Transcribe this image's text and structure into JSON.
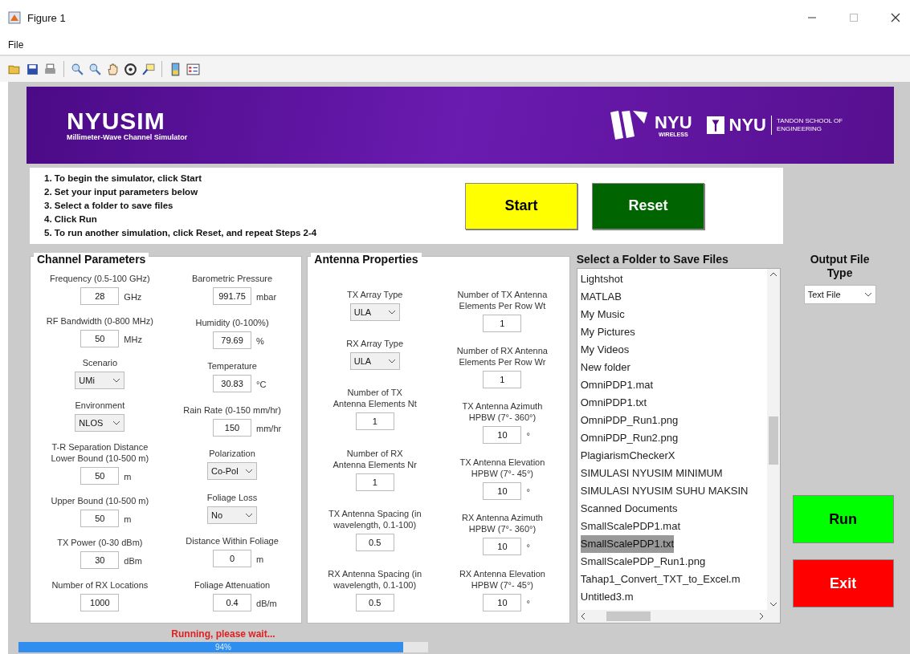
{
  "window": {
    "title": "Figure 1"
  },
  "menu": [
    "File"
  ],
  "banner": {
    "title": "NYUSIM",
    "subtitle": "Millimeter-Wave Channel Simulator",
    "logo1_name": "NYU",
    "logo1_sub": "WIRELESS",
    "logo2_name": "NYU",
    "logo2_sub": "TANDON SCHOOL OF ENGINEERING"
  },
  "instructions": [
    "1. To begin the simulator, click Start",
    "2. Set your input parameters below",
    "3. Select a folder to save files",
    "4. Click Run",
    "5. To run another simulation, click Reset, and repeat Steps 2-4"
  ],
  "top_buttons": [
    {
      "label": "Start",
      "kind": "start"
    },
    {
      "label": "Reset",
      "kind": "reset"
    }
  ],
  "channel": {
    "title": "Channel Parameters",
    "columns": [
      [
        {
          "kind": "input",
          "label": [
            "Frequency (0.5-100 GHz)"
          ],
          "value": "28",
          "unit": "GHz"
        },
        {
          "kind": "input",
          "label": [
            "RF Bandwidth (0-800 MHz)"
          ],
          "value": "50",
          "unit": "MHz"
        },
        {
          "kind": "select",
          "label": [
            "Scenario"
          ],
          "value": "UMi"
        },
        {
          "kind": "select",
          "label": [
            "Environment"
          ],
          "value": "NLOS"
        },
        {
          "kind": "input",
          "label": [
            "T-R Separation Distance",
            "Lower Bound (10-500 m)"
          ],
          "value": "50",
          "unit": "m"
        },
        {
          "kind": "input",
          "label": [
            "Upper Bound (10-500 m)"
          ],
          "value": "50",
          "unit": "m"
        },
        {
          "kind": "input",
          "label": [
            "TX Power (0-30 dBm)"
          ],
          "value": "30",
          "unit": "dBm"
        },
        {
          "kind": "input",
          "label": [
            "Number of RX Locations"
          ],
          "value": "1000"
        }
      ],
      [
        {
          "kind": "input",
          "label": [
            "Barometric Pressure"
          ],
          "value": "991.75",
          "unit": "mbar"
        },
        {
          "kind": "input",
          "label": [
            "Humidity (0-100%)"
          ],
          "value": "79.69",
          "unit": "%"
        },
        {
          "kind": "input",
          "label": [
            "Temperature"
          ],
          "value": "30.83",
          "unit": "°C"
        },
        {
          "kind": "input",
          "label": [
            "Rain Rate (0-150 mm/hr)"
          ],
          "value": "150",
          "unit": "mm/hr"
        },
        {
          "kind": "select",
          "label": [
            "Polarization"
          ],
          "value": "Co-Pol"
        },
        {
          "kind": "select",
          "label": [
            "Foliage Loss"
          ],
          "value": "No"
        },
        {
          "kind": "input",
          "label": [
            "Distance Within Foliage"
          ],
          "value": "0",
          "unit": "m"
        },
        {
          "kind": "input",
          "label": [
            "Foliage Attenuation"
          ],
          "value": "0.4",
          "unit": "dB/m"
        }
      ]
    ]
  },
  "antenna": {
    "title": "Antenna Properties",
    "columns": [
      [
        {
          "kind": "select",
          "label": [
            "TX Array Type"
          ],
          "value": "ULA"
        },
        {
          "kind": "select",
          "label": [
            "RX Array Type"
          ],
          "value": "ULA"
        },
        {
          "kind": "input",
          "label": [
            "Number of TX",
            "Antenna Elements Nt"
          ],
          "value": "1"
        },
        {
          "kind": "input",
          "label": [
            "Number of RX",
            "Antenna Elements Nr"
          ],
          "value": "1"
        },
        {
          "kind": "input",
          "label": [
            "TX Antenna Spacing (in",
            "wavelength, 0.1-100)"
          ],
          "value": "0.5"
        },
        {
          "kind": "input",
          "label": [
            "RX Antenna Spacing (in",
            "wavelength, 0.1-100)"
          ],
          "value": "0.5"
        }
      ],
      [
        {
          "kind": "input",
          "label": [
            "Number of TX Antenna",
            "Elements Per Row Wt"
          ],
          "value": "1"
        },
        {
          "kind": "input",
          "label": [
            "Number of RX Antenna",
            "Elements Per Row Wr"
          ],
          "value": "1"
        },
        {
          "kind": "input",
          "label": [
            "TX Antenna Azimuth",
            "HPBW (7°- 360°)"
          ],
          "value": "10",
          "unit": "°"
        },
        {
          "kind": "input",
          "label": [
            "TX Antenna Elevation",
            "HPBW (7°- 45°)"
          ],
          "value": "10",
          "unit": "°"
        },
        {
          "kind": "input",
          "label": [
            "RX Antenna Azimuth",
            "HPBW (7°- 360°)"
          ],
          "value": "10",
          "unit": "°"
        },
        {
          "kind": "input",
          "label": [
            "RX Antenna Elevation",
            "HPBW (7°- 45°)"
          ],
          "value": "10",
          "unit": "°"
        }
      ]
    ]
  },
  "folder": {
    "title": "Select a Folder to Save Files",
    "items": [
      {
        "label": "Lightshot",
        "selected": false
      },
      {
        "label": "MATLAB",
        "selected": false
      },
      {
        "label": "My Music",
        "selected": false
      },
      {
        "label": "My Pictures",
        "selected": false
      },
      {
        "label": "My Videos",
        "selected": false
      },
      {
        "label": "New folder",
        "selected": false
      },
      {
        "label": "OmniPDP1.mat",
        "selected": false
      },
      {
        "label": "OmniPDP1.txt",
        "selected": false
      },
      {
        "label": "OmniPDP_Run1.png",
        "selected": false
      },
      {
        "label": "OmniPDP_Run2.png",
        "selected": false
      },
      {
        "label": "PlagiarismCheckerX",
        "selected": false
      },
      {
        "label": "SIMULASI NYUSIM MINIMUM",
        "selected": false
      },
      {
        "label": "SIMULASI NYUSIM SUHU MAKSIN",
        "selected": false
      },
      {
        "label": "Scanned Documents",
        "selected": false
      },
      {
        "label": "SmallScalePDP1.mat",
        "selected": false
      },
      {
        "label": "SmallScalePDP1.txt",
        "selected": true
      },
      {
        "label": "SmallScalePDP_Run1.png",
        "selected": false
      },
      {
        "label": "Tahap1_Convert_TXT_to_Excel.m",
        "selected": false
      },
      {
        "label": "Untitled3.m",
        "selected": false
      }
    ]
  },
  "output": {
    "label": "Output File Type",
    "value": "Text File"
  },
  "side_buttons": [
    {
      "label": "Run",
      "kind": "run"
    },
    {
      "label": "Exit",
      "kind": "exit"
    }
  ],
  "progress": {
    "message": "Running, please wait...",
    "reading": "94%",
    "level": 0.94
  }
}
